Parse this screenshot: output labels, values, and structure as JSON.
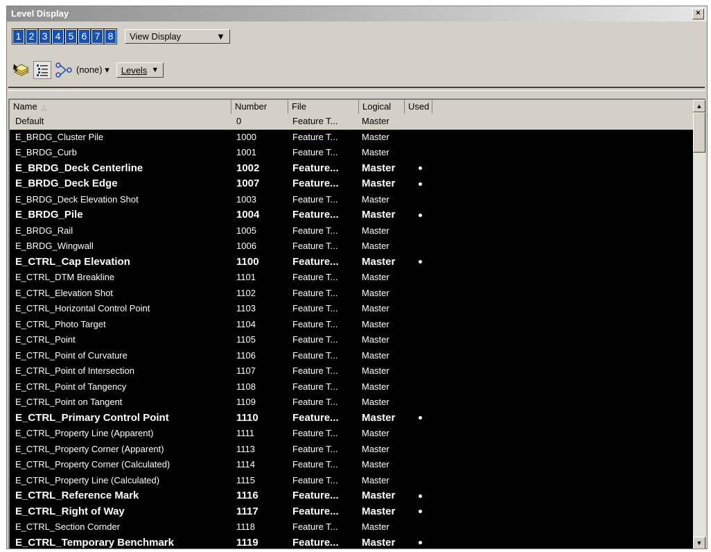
{
  "window": {
    "title": "Level Display",
    "close_label": "×"
  },
  "view_buttons": [
    "1",
    "2",
    "3",
    "4",
    "5",
    "6",
    "7",
    "8"
  ],
  "view_select": {
    "value": "View Display",
    "arrow": "▼"
  },
  "toolbar": {
    "icons": [
      "level-manager-icon",
      "details-view-icon",
      "filter-icon"
    ],
    "filter_value": "(none)",
    "filter_arrow": "▾",
    "levels_label": "Levels",
    "levels_arrow": "▼"
  },
  "table": {
    "columns": {
      "name": "Name",
      "sort": "△",
      "number": "Number",
      "file": "File",
      "logical": "Logical",
      "used": "Used"
    },
    "rows": [
      {
        "name": "Default",
        "number": "0",
        "file": "Feature T...",
        "logical": "Master",
        "used": false,
        "bold": false,
        "selected": true
      },
      {
        "name": "E_BRDG_Cluster Pile",
        "number": "1000",
        "file": "Feature T...",
        "logical": "Master",
        "used": false,
        "bold": false
      },
      {
        "name": "E_BRDG_Curb",
        "number": "1001",
        "file": "Feature T...",
        "logical": "Master",
        "used": false,
        "bold": false
      },
      {
        "name": "E_BRDG_Deck Centerline",
        "number": "1002",
        "file": "Feature...",
        "logical": "Master",
        "used": true,
        "bold": true
      },
      {
        "name": "E_BRDG_Deck Edge",
        "number": "1007",
        "file": "Feature...",
        "logical": "Master",
        "used": true,
        "bold": true
      },
      {
        "name": "E_BRDG_Deck Elevation Shot",
        "number": "1003",
        "file": "Feature T...",
        "logical": "Master",
        "used": false,
        "bold": false
      },
      {
        "name": "E_BRDG_Pile",
        "number": "1004",
        "file": "Feature...",
        "logical": "Master",
        "used": true,
        "bold": true
      },
      {
        "name": "E_BRDG_Rail",
        "number": "1005",
        "file": "Feature T...",
        "logical": "Master",
        "used": false,
        "bold": false
      },
      {
        "name": "E_BRDG_Wingwall",
        "number": "1006",
        "file": "Feature T...",
        "logical": "Master",
        "used": false,
        "bold": false
      },
      {
        "name": "E_CTRL_Cap Elevation",
        "number": "1100",
        "file": "Feature...",
        "logical": "Master",
        "used": true,
        "bold": true
      },
      {
        "name": "E_CTRL_DTM Breakline",
        "number": "1101",
        "file": "Feature T...",
        "logical": "Master",
        "used": false,
        "bold": false
      },
      {
        "name": "E_CTRL_Elevation Shot",
        "number": "1102",
        "file": "Feature T...",
        "logical": "Master",
        "used": false,
        "bold": false
      },
      {
        "name": "E_CTRL_Horizontal Control Point",
        "number": "1103",
        "file": "Feature T...",
        "logical": "Master",
        "used": false,
        "bold": false
      },
      {
        "name": "E_CTRL_Photo Target",
        "number": "1104",
        "file": "Feature T...",
        "logical": "Master",
        "used": false,
        "bold": false
      },
      {
        "name": "E_CTRL_Point",
        "number": "1105",
        "file": "Feature T...",
        "logical": "Master",
        "used": false,
        "bold": false
      },
      {
        "name": "E_CTRL_Point of Curvature",
        "number": "1106",
        "file": "Feature T...",
        "logical": "Master",
        "used": false,
        "bold": false
      },
      {
        "name": "E_CTRL_Point of Intersection",
        "number": "1107",
        "file": "Feature T...",
        "logical": "Master",
        "used": false,
        "bold": false
      },
      {
        "name": "E_CTRL_Point of Tangency",
        "number": "1108",
        "file": "Feature T...",
        "logical": "Master",
        "used": false,
        "bold": false
      },
      {
        "name": "E_CTRL_Point on Tangent",
        "number": "1109",
        "file": "Feature T...",
        "logical": "Master",
        "used": false,
        "bold": false
      },
      {
        "name": "E_CTRL_Primary Control Point",
        "number": "1110",
        "file": "Feature...",
        "logical": "Master",
        "used": true,
        "bold": true
      },
      {
        "name": "E_CTRL_Property Line (Apparent)",
        "number": "1111",
        "file": "Feature T...",
        "logical": "Master",
        "used": false,
        "bold": false
      },
      {
        "name": "E_CTRL_Property Corner (Apparent)",
        "number": "1113",
        "file": "Feature T...",
        "logical": "Master",
        "used": false,
        "bold": false
      },
      {
        "name": "E_CTRL_Property Corner (Calculated)",
        "number": "1114",
        "file": "Feature T...",
        "logical": "Master",
        "used": false,
        "bold": false
      },
      {
        "name": "E_CTRL_Property Line (Calculated)",
        "number": "1115",
        "file": "Feature T...",
        "logical": "Master",
        "used": false,
        "bold": false
      },
      {
        "name": "E_CTRL_Reference Mark",
        "number": "1116",
        "file": "Feature...",
        "logical": "Master",
        "used": true,
        "bold": true
      },
      {
        "name": "E_CTRL_Right of Way",
        "number": "1117",
        "file": "Feature...",
        "logical": "Master",
        "used": true,
        "bold": true
      },
      {
        "name": "E_CTRL_Section Cornder",
        "number": "1118",
        "file": "Feature T...",
        "logical": "Master",
        "used": false,
        "bold": false
      },
      {
        "name": "E_CTRL_Temporary Benchmark",
        "number": "1119",
        "file": "Feature...",
        "logical": "Master",
        "used": true,
        "bold": true
      }
    ]
  },
  "scrollbar": {
    "up": "▲",
    "down": "▼"
  }
}
